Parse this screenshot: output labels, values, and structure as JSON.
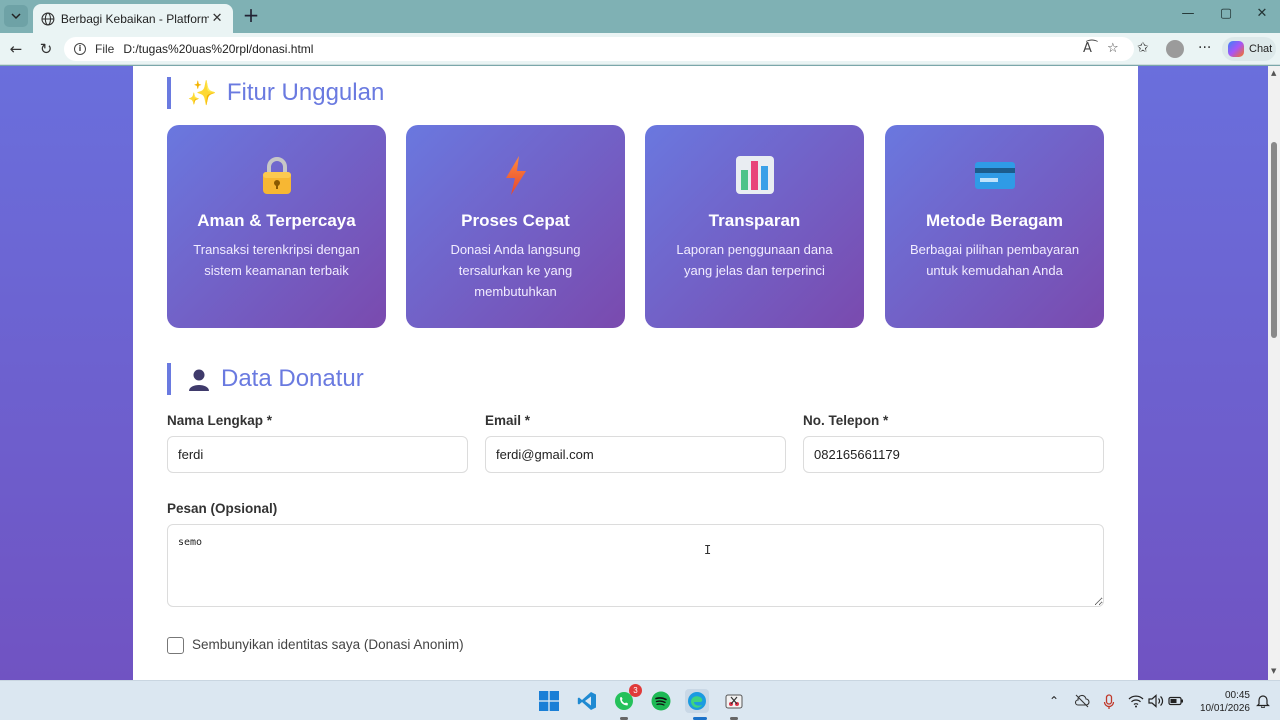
{
  "browser": {
    "tab_title": "Berbagi Kebaikan - Platform Donasi",
    "address_prefix": "File",
    "url": "D:/tugas%20uas%20rpl/donasi.html",
    "chat_label": "Chat"
  },
  "features_section": {
    "title": "Fitur Unggulan",
    "icon": "sparkles-icon",
    "cards": [
      {
        "icon": "lock-icon",
        "title": "Aman & Terpercaya",
        "desc": "Transaksi terenkripsi dengan sistem keamanan terbaik"
      },
      {
        "icon": "lightning-icon",
        "title": "Proses Cepat",
        "desc": "Donasi Anda langsung tersalurkan ke yang membutuhkan"
      },
      {
        "icon": "bar-chart-icon",
        "title": "Transparan",
        "desc": "Laporan penggunaan dana yang jelas dan terperinci"
      },
      {
        "icon": "credit-card-icon",
        "title": "Metode Beragam",
        "desc": "Berbagai pilihan pembayaran untuk kemudahan Anda"
      }
    ]
  },
  "donor_section": {
    "title": "Data Donatur",
    "icon": "person-icon",
    "name_label": "Nama Lengkap *",
    "name_value": "ferdi",
    "email_label": "Email *",
    "email_value": "ferdi@gmail.com",
    "phone_label": "No. Telepon *",
    "phone_value": "082165661179",
    "message_label": "Pesan (Opsional)",
    "message_value": "semo",
    "anonymous_label": "Sembunyikan identitas saya (Donasi Anonim)",
    "anonymous_checked": false
  },
  "taskbar": {
    "whatsapp_badge": "3",
    "time": "00:45",
    "date": "10/01/2026"
  },
  "colors": {
    "accent": "#6a7ae0",
    "card_gradient_start": "#6a78df",
    "card_gradient_end": "#7a4aae",
    "page_background": "#6a6fdc"
  }
}
